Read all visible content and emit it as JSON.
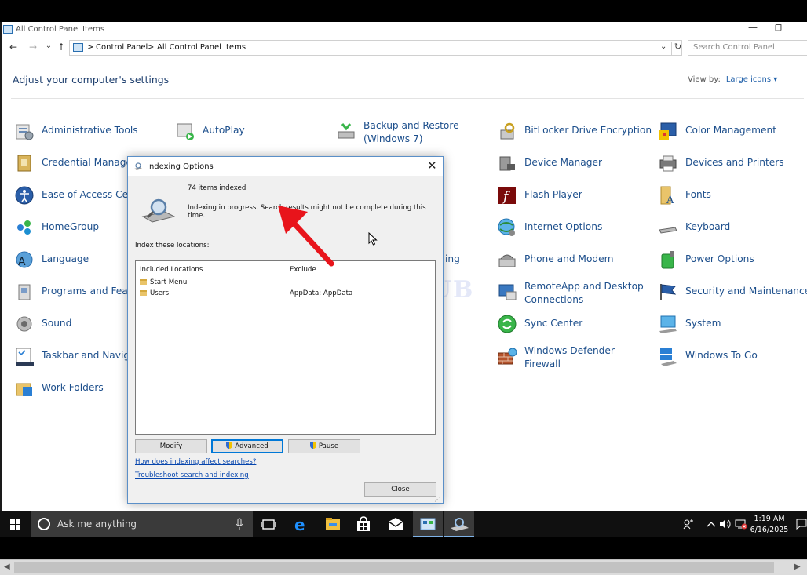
{
  "window": {
    "title": "All Control Panel Items",
    "min_glyph": "—",
    "restore_glyph": "❐"
  },
  "address": {
    "back": "←",
    "forward": "→",
    "recent": "⌄",
    "up": "↑",
    "crumb_sep": ">",
    "crumb1": "Control Panel",
    "crumb2": "All Control Panel Items",
    "drop": "⌄",
    "refresh": "↻",
    "search_placeholder": "Search Control Panel"
  },
  "header": {
    "title": "Adjust your computer's settings",
    "viewby_label": "View by:",
    "viewby_value": "Large icons ▾"
  },
  "items": {
    "administrative_tools": "Administrative Tools",
    "autoplay": "AutoPlay",
    "backup_restore_1": "Backup and Restore",
    "backup_restore_2": "(Windows 7)",
    "bitlocker": "BitLocker Drive Encryption",
    "color_management": "Color Management",
    "credential_manager": "Credential Manager",
    "device_manager": "Device Manager",
    "devices_printers": "Devices and Printers",
    "ease_of_access": "Ease of Access Cent",
    "flash_player": "Flash Player",
    "fonts": "Fonts",
    "homegroup": "HomeGroup",
    "internet_options": "Internet Options",
    "keyboard": "Keyboard",
    "language": "Language",
    "indexing_partial": "ing",
    "phone_modem": "Phone and Modem",
    "power_options": "Power Options",
    "programs_features": "Programs and Featu",
    "remoteapp_1": "RemoteApp and Desktop",
    "remoteapp_2": "Connections",
    "security_maintenance": "Security and Maintenance",
    "sound": "Sound",
    "sync_center": "Sync Center",
    "system": "System",
    "taskbar_navigation": "Taskbar and Naviga",
    "defender_1": "Windows Defender",
    "defender_2": "Firewall",
    "windows_to_go": "Windows To Go",
    "work_folders": "Work Folders"
  },
  "watermark": "IT Pros HUB",
  "dialog": {
    "title": "Indexing Options",
    "close_glyph": "✕",
    "items_indexed": "74 items indexed",
    "status": "Indexing in progress. Search results might not be complete during this time.",
    "index_label": "Index these locations:",
    "col_included": "Included Locations",
    "col_exclude": "Exclude",
    "locations": [
      {
        "name": "Start Menu",
        "exclude": ""
      },
      {
        "name": "Users",
        "exclude": "AppData; AppData"
      }
    ],
    "modify": "Modify",
    "advanced": "Advanced",
    "pause": "Pause",
    "link1": "How does indexing affect searches?",
    "link2": "Troubleshoot search and indexing",
    "close": "Close"
  },
  "taskbar": {
    "search_placeholder": "Ask me anything",
    "time": "1:19 AM",
    "date": "6/16/2025"
  },
  "colors": {
    "accent": "#0078d7",
    "link": "#1d4f8c",
    "taskbar": "#101010"
  }
}
